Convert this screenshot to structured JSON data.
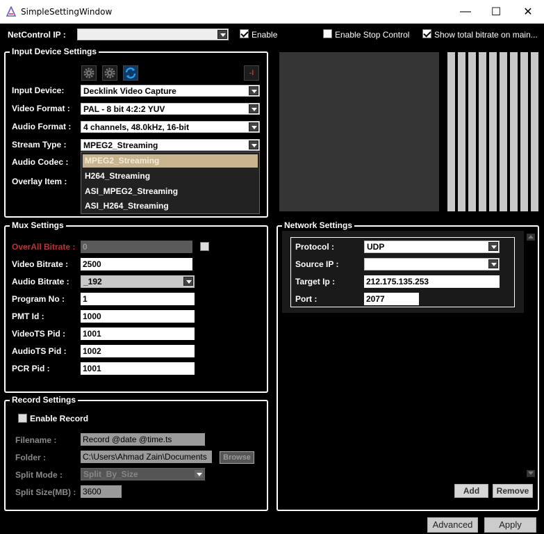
{
  "window": {
    "title": "SimpleSettingWindow",
    "minimize": "—",
    "maximize": "☐",
    "close": "✕"
  },
  "top": {
    "netcontrol_label": "NetControl IP :",
    "netcontrol_value": "",
    "enable_label": "Enable",
    "enable_checked": true,
    "stop_control_label": "Enable Stop Control",
    "stop_control_checked": false,
    "show_bitrate_label": "Show total bitrate on main...",
    "show_bitrate_checked": true
  },
  "input_device": {
    "title": "Input Device Settings",
    "input_device_label": "Input Device:",
    "input_device_value": "Decklink Video Capture",
    "video_format_label": "Video Format :",
    "video_format_value": "PAL - 8 bit 4:2:2 YUV",
    "audio_format_label": "Audio Format :",
    "audio_format_value": "4 channels, 48.0kHz, 16-bit",
    "stream_type_label": "Stream Type :",
    "stream_type_value": "MPEG2_Streaming",
    "audio_codec_label": "Audio Codec :",
    "overlay_item_label": "Overlay Item :",
    "stream_type_options": [
      "MPEG2_Streaming",
      "H264_Streaming",
      "ASI_MPEG2_Streaming",
      "ASI_H264_Streaming"
    ],
    "remove_glyph": "-I"
  },
  "mux": {
    "title": "Mux Settings",
    "overall_bitrate_label": "OverAll Bitrate :",
    "overall_bitrate_value": "0",
    "video_bitrate_label": "Video Bitrate :",
    "video_bitrate_value": "2500",
    "audio_bitrate_label": "Audio Bitrate :",
    "audio_bitrate_value": "_192",
    "program_no_label": "Program No :",
    "program_no_value": "1",
    "pmt_id_label": "PMT Id :",
    "pmt_id_value": "1000",
    "videots_pid_label": "VideoTS Pid :",
    "videots_pid_value": "1001",
    "audiots_pid_label": "AudioTS Pid :",
    "audiots_pid_value": "1002",
    "pcr_pid_label": "PCR Pid :",
    "pcr_pid_value": "1001"
  },
  "record": {
    "title": "Record Settings",
    "enable_record_label": "Enable Record",
    "enable_record_checked": false,
    "filename_label": "Filename :",
    "filename_value": "Record @date @time.ts",
    "folder_label": "Folder :",
    "folder_value": "C:\\Users\\Ahmad Zain\\Documents",
    "browse_label": "Browse",
    "split_mode_label": "Split Mode :",
    "split_mode_value": "Split_By_Size",
    "split_size_label": "Split Size(MB) :",
    "split_size_value": "3600"
  },
  "network": {
    "title": "Network Settings",
    "protocol_label": "Protocol :",
    "protocol_value": "UDP",
    "source_ip_label": "Source IP :",
    "source_ip_value": "",
    "target_ip_label": "Target Ip :",
    "target_ip_value": "212.175.135.253",
    "port_label": "Port :",
    "port_value": "2077",
    "add_label": "Add",
    "remove_label": "Remove"
  },
  "footer": {
    "advanced_label": "Advanced",
    "apply_label": "Apply"
  },
  "colors": {
    "accent_blue": "#1e90d8",
    "selected_item": "#c8b48e",
    "warn_red": "#b33333"
  }
}
